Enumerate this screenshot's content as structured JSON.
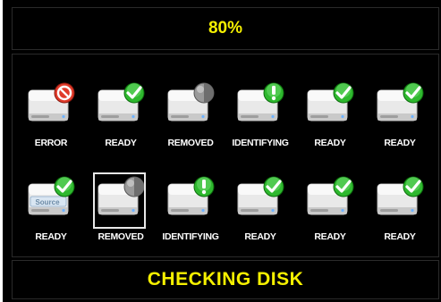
{
  "progress": {
    "text": "80%",
    "value": 80
  },
  "status": {
    "text": "CHECKING DISK"
  },
  "colors": {
    "accent": "#f5f000",
    "background": "#000000",
    "label": "#ffffff"
  },
  "drives": [
    {
      "label": "ERROR",
      "state": "error",
      "icon": "no-entry-icon"
    },
    {
      "label": "READY",
      "state": "ready",
      "icon": "checkmark-icon"
    },
    {
      "label": "REMOVED",
      "state": "removed",
      "icon": "gray-disc-icon"
    },
    {
      "label": "IDENTIFYING",
      "state": "identifying",
      "icon": "exclamation-icon"
    },
    {
      "label": "READY",
      "state": "ready",
      "icon": "checkmark-icon"
    },
    {
      "label": "READY",
      "state": "ready",
      "icon": "checkmark-icon"
    },
    {
      "label": "READY",
      "state": "ready",
      "icon": "checkmark-icon",
      "badge_text": "Source",
      "source": true
    },
    {
      "label": "REMOVED",
      "state": "removed",
      "icon": "gray-disc-icon",
      "selected": true
    },
    {
      "label": "IDENTIFYING",
      "state": "identifying",
      "icon": "exclamation-icon"
    },
    {
      "label": "READY",
      "state": "ready",
      "icon": "checkmark-icon"
    },
    {
      "label": "READY",
      "state": "ready",
      "icon": "checkmark-icon"
    },
    {
      "label": "READY",
      "state": "ready",
      "icon": "checkmark-icon"
    }
  ]
}
